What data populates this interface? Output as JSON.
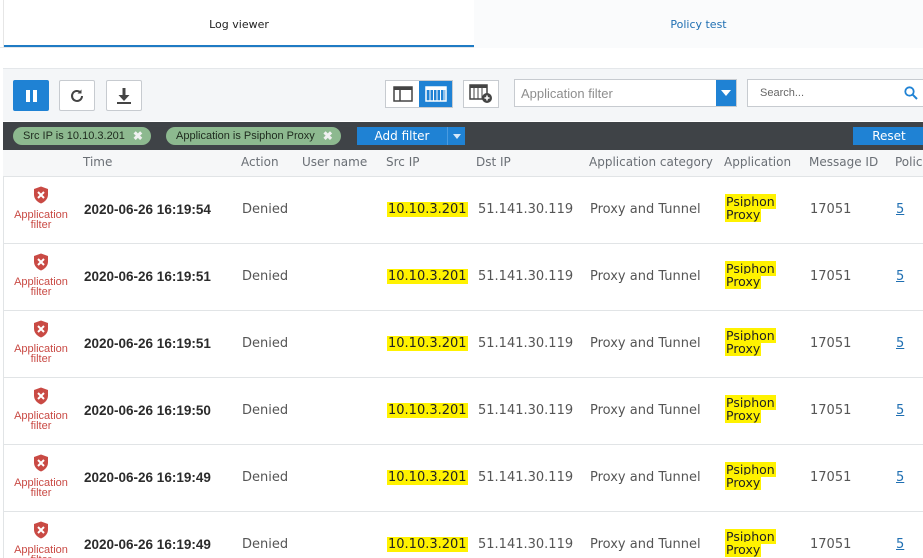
{
  "tabs": [
    {
      "label": "Log viewer",
      "active": true
    },
    {
      "label": "Policy test",
      "active": false
    }
  ],
  "toolbar": {
    "pause_icon": "pause-icon",
    "refresh_icon": "refresh-icon",
    "download_icon": "download-icon",
    "app_filter_placeholder": "Application filter",
    "search_placeholder": "Search..."
  },
  "filters": {
    "chips": [
      {
        "label": "Src IP is 10.10.3.201"
      },
      {
        "label": "Application is Psiphon Proxy"
      }
    ],
    "add_filter_label": "Add filter",
    "reset_label": "Reset"
  },
  "table": {
    "headers": [
      "Time",
      "Action",
      "User name",
      "Src IP",
      "Dst IP",
      "Application category",
      "Application",
      "Message ID",
      "Polic"
    ],
    "rows": [
      {
        "type_line1": "Application",
        "type_line2": "filter",
        "time": "2020-06-26 16:19:54",
        "action": "Denied",
        "user": "",
        "src_ip": "10.10.3.201",
        "dst_ip": "51.141.30.119",
        "category": "Proxy and Tunnel",
        "app_line1": "Psiphon",
        "app_line2": "Proxy",
        "msg_id": "17051",
        "policy": "5"
      },
      {
        "type_line1": "Application",
        "type_line2": "filter",
        "time": "2020-06-26 16:19:51",
        "action": "Denied",
        "user": "",
        "src_ip": "10.10.3.201",
        "dst_ip": "51.141.30.119",
        "category": "Proxy and Tunnel",
        "app_line1": "Psiphon",
        "app_line2": "Proxy",
        "msg_id": "17051",
        "policy": "5"
      },
      {
        "type_line1": "Application",
        "type_line2": "filter",
        "time": "2020-06-26 16:19:51",
        "action": "Denied",
        "user": "",
        "src_ip": "10.10.3.201",
        "dst_ip": "51.141.30.119",
        "category": "Proxy and Tunnel",
        "app_line1": "Psiphon",
        "app_line2": "Proxy",
        "msg_id": "17051",
        "policy": "5"
      },
      {
        "type_line1": "Application",
        "type_line2": "filter",
        "time": "2020-06-26 16:19:50",
        "action": "Denied",
        "user": "",
        "src_ip": "10.10.3.201",
        "dst_ip": "51.141.30.119",
        "category": "Proxy and Tunnel",
        "app_line1": "Psiphon",
        "app_line2": "Proxy",
        "msg_id": "17051",
        "policy": "5"
      },
      {
        "type_line1": "Application",
        "type_line2": "filter",
        "time": "2020-06-26 16:19:49",
        "action": "Denied",
        "user": "",
        "src_ip": "10.10.3.201",
        "dst_ip": "51.141.30.119",
        "category": "Proxy and Tunnel",
        "app_line1": "Psiphon",
        "app_line2": "Proxy",
        "msg_id": "17051",
        "policy": "5"
      },
      {
        "type_line1": "Application",
        "type_line2": "filter",
        "time": "2020-06-26 16:19:49",
        "action": "Denied",
        "user": "",
        "src_ip": "10.10.3.201",
        "dst_ip": "51.141.30.119",
        "category": "Proxy and Tunnel",
        "app_line1": "Psiphon",
        "app_line2": "Proxy",
        "msg_id": "17051",
        "policy": "5"
      }
    ]
  },
  "colors": {
    "accent": "#1f82d4",
    "highlight": "#fff200",
    "denied_red": "#c94a44",
    "chip_green": "#8db98f",
    "filterbar_bg": "#3f4347"
  }
}
